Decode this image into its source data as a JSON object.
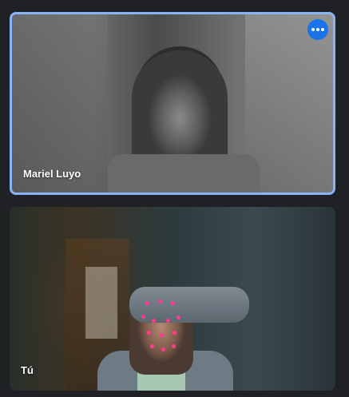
{
  "participants": [
    {
      "name": "Mariel Luyo",
      "active_speaker": true,
      "more_icon": "more-horizontal-icon"
    },
    {
      "name": "Tú",
      "active_speaker": false
    }
  ],
  "colors": {
    "background": "#202124",
    "active_border": "#8ab4f8",
    "more_button": "#1a73e8",
    "face_effect_dots": "#ff3b8d"
  }
}
